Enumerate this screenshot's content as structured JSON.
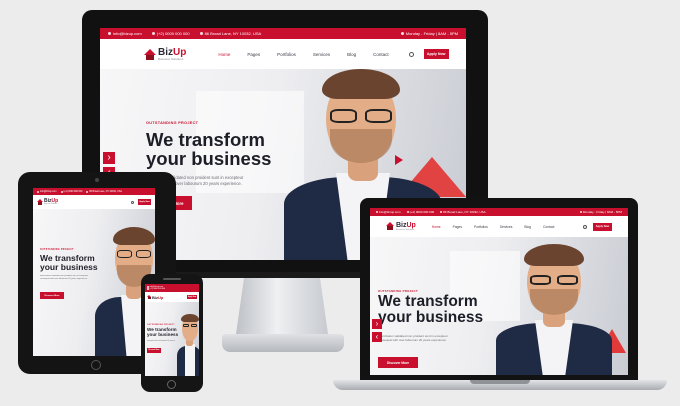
{
  "site": {
    "topbar": {
      "email": "info@bizup.com",
      "phone": "(+2) 0000 000 000",
      "address": "86 Broad Lane, NY 10032, USA",
      "hours": "Monday - Friday | 8AM - 5PM"
    },
    "logo": {
      "name_dark": "Biz",
      "name_red": "Up",
      "tagline": "Business Solutions"
    },
    "menu": [
      {
        "label": "Home",
        "active": true
      },
      {
        "label": "Pages",
        "active": false
      },
      {
        "label": "Portfolios",
        "active": false
      },
      {
        "label": "Services",
        "active": false
      },
      {
        "label": "Blog",
        "active": false
      },
      {
        "label": "Contact",
        "active": false
      }
    ],
    "apply_label": "Apply Now",
    "hero": {
      "eyebrow": "OUTSTANDING PROJECT",
      "headline_line1": "We transform",
      "headline_line2": "your business",
      "description_line1": "Exercitation validated non proident sunt in excepteur",
      "description_line2": "consequat with over labourum 20 years experience.",
      "cta_label": "Discover More",
      "arrow_left": "‹",
      "arrow_right": "›"
    }
  },
  "colors": {
    "brand_red": "#c8102e",
    "navy": "#1f2a44"
  }
}
